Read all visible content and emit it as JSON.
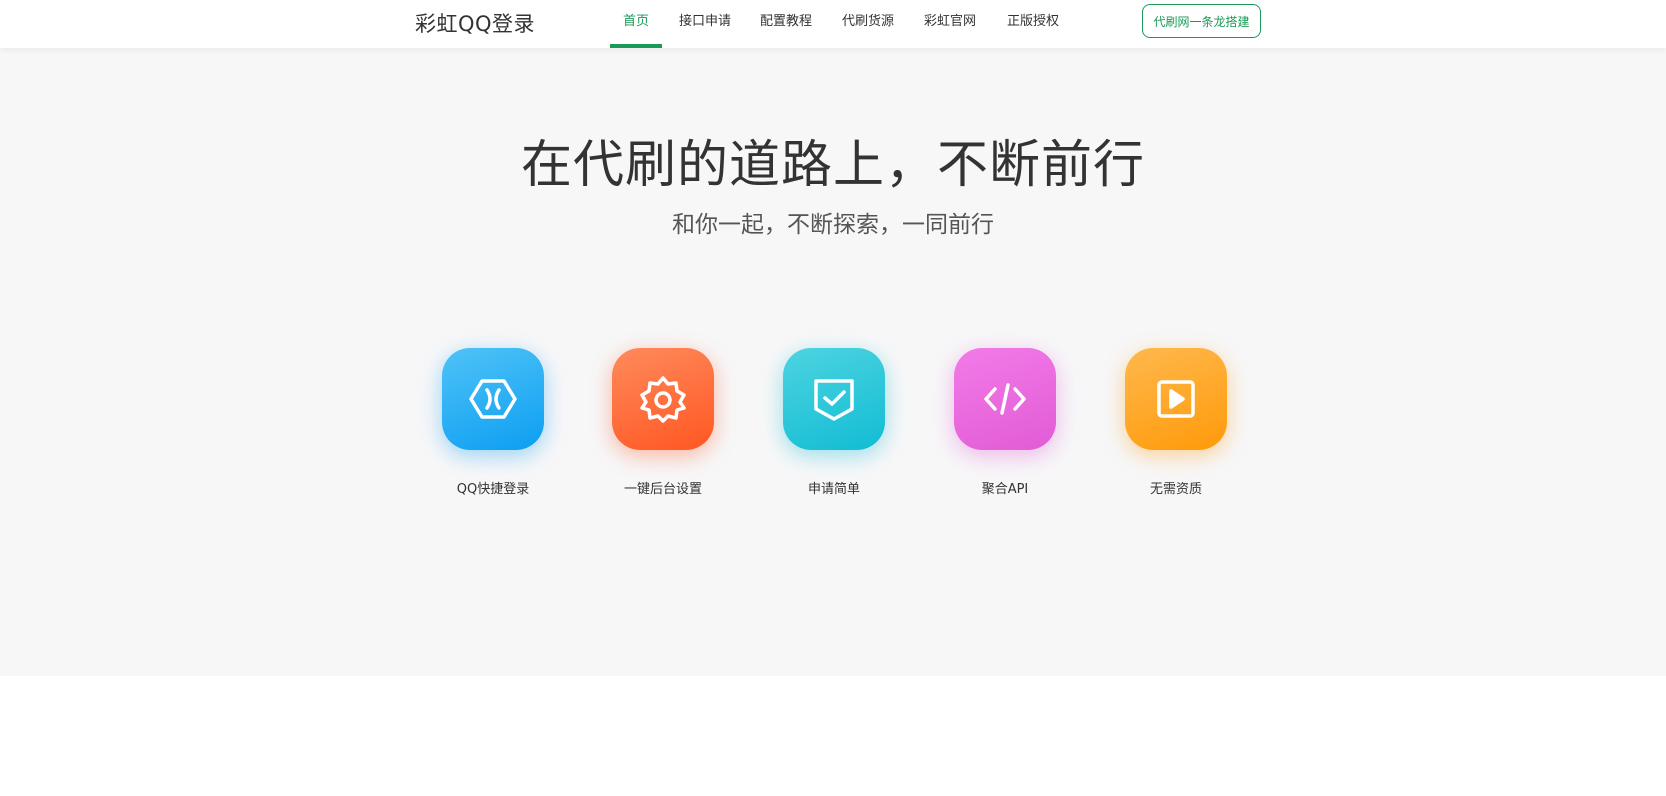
{
  "brand": {
    "title": "彩虹QQ登录"
  },
  "nav": {
    "items": [
      {
        "label": "首页",
        "active": true
      },
      {
        "label": "接口申请",
        "active": false
      },
      {
        "label": "配置教程",
        "active": false
      },
      {
        "label": "代刷货源",
        "active": false
      },
      {
        "label": "彩虹官网",
        "active": false
      },
      {
        "label": "正版授权",
        "active": false
      }
    ],
    "cta_label": "代刷网一条龙搭建"
  },
  "hero": {
    "title": "在代刷的道路上，不断前行",
    "subtitle": "和你一起，不断探索，一同前行"
  },
  "features": [
    {
      "label": "QQ快捷登录",
      "icon": "hexagon-x-icon",
      "color_from": "#4fc3f7",
      "color_to": "#0d9ef2"
    },
    {
      "label": "一键后台设置",
      "icon": "gear-icon",
      "color_from": "#ff8a5c",
      "color_to": "#ff5722"
    },
    {
      "label": "申请简单",
      "icon": "check-shield-icon",
      "color_from": "#4dd4e0",
      "color_to": "#12bcd4"
    },
    {
      "label": "聚合API",
      "icon": "code-icon",
      "color_from": "#f27be8",
      "color_to": "#e25bd5"
    },
    {
      "label": "无需资质",
      "icon": "play-icon",
      "color_from": "#ffb84d",
      "color_to": "#ff9a0a"
    }
  ],
  "colors": {
    "accent": "#1a9a56",
    "hero_bg": "#f7f7f8"
  }
}
